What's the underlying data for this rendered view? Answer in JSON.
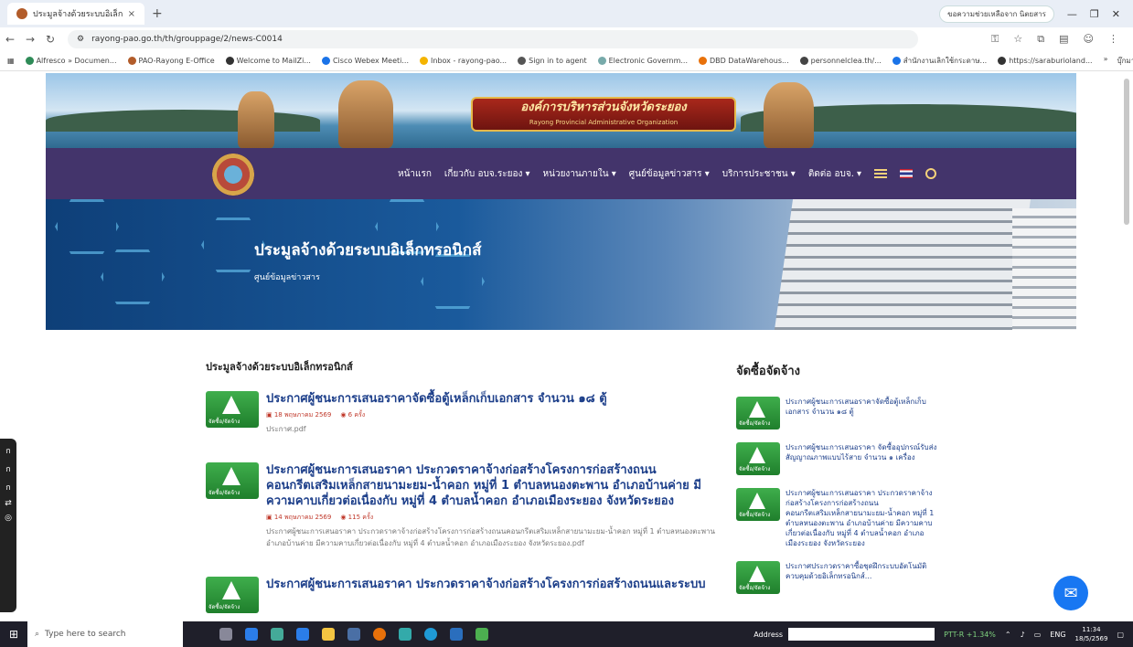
{
  "browser": {
    "tab_title": "ประมูลจ้างด้วยระบบอิเล็กทรอนิกส์",
    "tab_close": "×",
    "new_tab": "+",
    "profile_pill": "ขอความช่วยเหลือจาก นิตยสาร",
    "url": "rayong-pao.go.th/th/grouppage/2/news-C0014",
    "bookmarks": [
      "Alfresco » Documen...",
      "PAO-Rayong E-Office",
      "Welcome to MailZi...",
      "Cisco Webex Meeti...",
      "Inbox - rayong-pao...",
      "Sign in to agent",
      "Electronic Governm...",
      "DBD DataWarehous...",
      "personnelclea.th/...",
      "สำนักงานเลิกใช้กระดาษ...",
      "https://saraburioland..."
    ],
    "bookmarks_folder": "บุ๊กมาร์กทั้งหมด"
  },
  "site": {
    "banner_title": "องค์การบริหารส่วนจังหวัดระยอง",
    "banner_subtitle": "Rayong Provincial Administrative Organization",
    "menu": [
      "หน้าแรก",
      "เกี่ยวกับ อบจ.ระยอง ▾",
      "หน่วยงานภายใน ▾",
      "ศูนย์ข้อมูลข่าวสาร ▾",
      "บริการประชาชน ▾",
      "ติดต่อ อบจ. ▾"
    ],
    "hero_title": "ประมูลจ้างด้วยระบบอิเล็กทรอนิกส์",
    "hero_crumb": "ศูนย์ข้อมูลข่าวสาร"
  },
  "main": {
    "section_title": "ประมูลจ้างด้วยระบบอิเล็กทรอนิกส์",
    "news": [
      {
        "title": "ประกาศผู้ชนะการเสนอราคาจัดซื้อตู้เหล็กเก็บเอกสาร จำนวน ๑๘ ตู้",
        "date": "18 พฤษภาคม 2569",
        "views": "6 ครั้ง",
        "file": "ประกาศ.pdf"
      },
      {
        "title": "ประกาศผู้ชนะการเสนอราคา ประกวดราคาจ้างก่อสร้างโครงการก่อสร้างถนนคอนกรีตเสริมเหล็กสายนามะยม-น้ำคอก หมู่ที่ 1 ตำบลหนองตะพาน อำเภอบ้านค่าย มีความคาบเกี่ยวต่อเนื่องกับ หมู่ที่ 4 ตำบลน้ำคอก อำเภอเมืองระยอง จังหวัดระยอง",
        "date": "14 พฤษภาคม 2569",
        "views": "115 ครั้ง",
        "file": "ประกาศผู้ชนะการเสนอราคา ประกวดราคาจ้างก่อสร้างโครงการก่อสร้างถนนคอนกรีตเสริมเหล็กสายนามะยม-น้ำคอก หมู่ที่ 1 ตำบลหนองตะพาน อำเภอบ้านค่าย มีความคาบเกี่ยวต่อเนื่องกับ หมู่ที่ 4 ตำบลน้ำคอก อำเภอเมืองระยอง จังหวัดระยอง.pdf"
      },
      {
        "title": "ประกาศผู้ชนะการเสนอราคา ประกวดราคาจ้างก่อสร้างโครงการก่อสร้างถนนและระบบ",
        "date": "",
        "views": "",
        "file": ""
      }
    ]
  },
  "sidebar": {
    "title": "จัดซื้อจัดจ้าง",
    "items": [
      "ประกาศผู้ชนะการเสนอราคาจัดซื้อตู้เหล็กเก็บเอกสาร จำนวน ๑๘ ตู้",
      "ประกาศผู้ชนะการเสนอราคา จัดซื้ออุปกรณ์รับส่งสัญญาณภาพแบบไร้สาย จำนวน ๑ เครื่อง",
      "ประกาศผู้ชนะการเสนอราคา ประกวดราคาจ้างก่อสร้างโครงการก่อสร้างถนนคอนกรีตเสริมเหล็กสายนามะยม-น้ำคอก หมู่ที่ 1 ตำบลหนองตะพาน อำเภอบ้านค่าย มีความคาบเกี่ยวต่อเนื่องกับ หมู่ที่ 4 ตำบลน้ำคอก อำเภอเมืองระยอง จังหวัดระยอง",
      "ประกาศประกวดราคาซื้อชุดฝึกระบบอัตโนมัติควบคุมด้วยอิเล็กทรอนิกส์..."
    ]
  },
  "taskbar": {
    "search_placeholder": "Type here to search",
    "address_label": "Address",
    "stock": "PTT-R +1.34%",
    "lang": "ENG",
    "time": "11:34",
    "date": "18/5/2569"
  },
  "colors": {
    "nav": "#43346b",
    "title": "#1d3f8a",
    "accent": "#c0392b"
  }
}
